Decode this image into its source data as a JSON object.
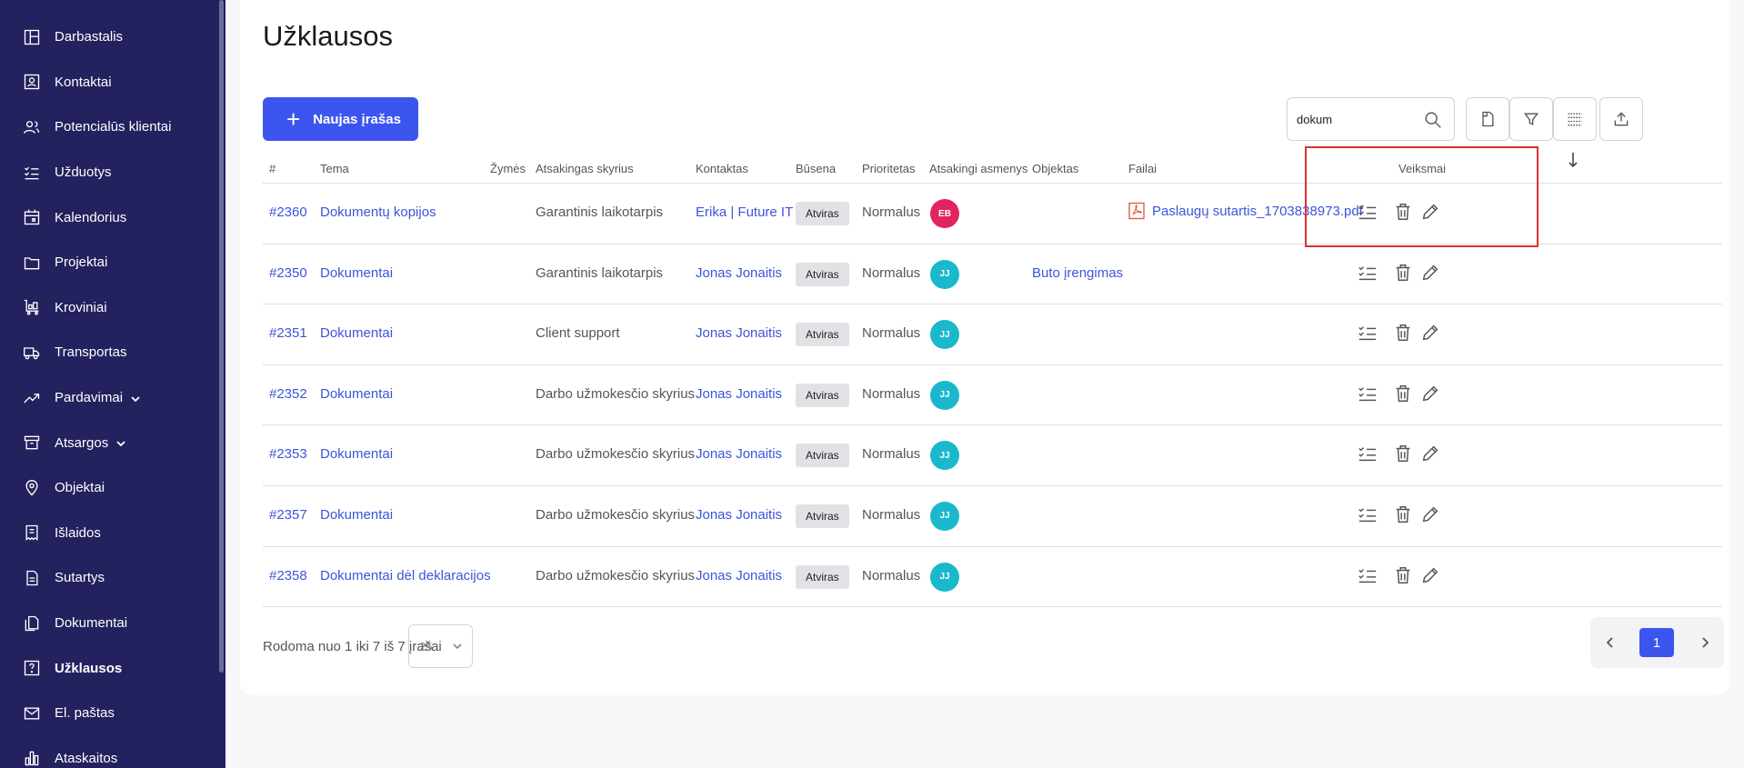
{
  "sidebar": {
    "items": [
      {
        "label": "Darbastalis",
        "icon": "dashboard-icon"
      },
      {
        "label": "Kontaktai",
        "icon": "contact-card-icon"
      },
      {
        "label": "Potencialūs klientai",
        "icon": "users-icon"
      },
      {
        "label": "Užduotys",
        "icon": "checklist-icon"
      },
      {
        "label": "Kalendorius",
        "icon": "calendar-icon"
      },
      {
        "label": "Projektai",
        "icon": "folder-icon"
      },
      {
        "label": "Kroviniai",
        "icon": "cart-icon"
      },
      {
        "label": "Transportas",
        "icon": "truck-icon"
      },
      {
        "label": "Pardavimai",
        "icon": "trend-icon",
        "expandable": true
      },
      {
        "label": "Atsargos",
        "icon": "archive-icon",
        "expandable": true
      },
      {
        "label": "Objektai",
        "icon": "map-pin-icon"
      },
      {
        "label": "Išlaidos",
        "icon": "receipt-icon"
      },
      {
        "label": "Sutartys",
        "icon": "document-icon"
      },
      {
        "label": "Dokumentai",
        "icon": "documents-icon"
      },
      {
        "label": "Užklausos",
        "icon": "question-icon",
        "active": true
      },
      {
        "label": "El. paštas",
        "icon": "mail-icon"
      },
      {
        "label": "Ataskaitos",
        "icon": "bar-chart-icon"
      }
    ]
  },
  "page": {
    "title": "Užklausos",
    "new_button_label": "Naujas įrašas",
    "search_value": "dokum"
  },
  "table": {
    "headers": {
      "id": "#",
      "subject": "Tema",
      "tags": "Žymės",
      "department": "Atsakingas skyrius",
      "contact": "Kontaktas",
      "status": "Būsena",
      "priority": "Prioritetas",
      "assignees": "Atsakingi asmenys",
      "object": "Objektas",
      "files": "Failai",
      "actions": "Veiksmai"
    },
    "rows": [
      {
        "id": "#2360",
        "subject": "Dokumentų kopijos",
        "department": "Garantinis laikotarpis",
        "contact": "Erika | Future IT",
        "status": "Atviras",
        "priority": "Normalus",
        "avatar": "EB",
        "avatar_color": "#e0245e",
        "object": "",
        "file": "Paslaugų sutartis_1703838973.pdf"
      },
      {
        "id": "#2350",
        "subject": "Dokumentai",
        "department": "Garantinis laikotarpis",
        "contact": "Jonas Jonaitis",
        "status": "Atviras",
        "priority": "Normalus",
        "avatar": "JJ",
        "avatar_color": "#1ab8cc",
        "object": "Buto įrengimas",
        "file": ""
      },
      {
        "id": "#2351",
        "subject": "Dokumentai",
        "department": "Client support",
        "contact": "Jonas Jonaitis",
        "status": "Atviras",
        "priority": "Normalus",
        "avatar": "JJ",
        "avatar_color": "#1ab8cc",
        "object": "",
        "file": ""
      },
      {
        "id": "#2352",
        "subject": "Dokumentai",
        "department": "Darbo užmokesčio skyrius",
        "contact": "Jonas Jonaitis",
        "status": "Atviras",
        "priority": "Normalus",
        "avatar": "JJ",
        "avatar_color": "#1ab8cc",
        "object": "",
        "file": ""
      },
      {
        "id": "#2353",
        "subject": "Dokumentai",
        "department": "Darbo užmokesčio skyrius",
        "contact": "Jonas Jonaitis",
        "status": "Atviras",
        "priority": "Normalus",
        "avatar": "JJ",
        "avatar_color": "#1ab8cc",
        "object": "",
        "file": ""
      },
      {
        "id": "#2357",
        "subject": "Dokumentai",
        "department": "Darbo užmokesčio skyrius",
        "contact": "Jonas Jonaitis",
        "status": "Atviras",
        "priority": "Normalus",
        "avatar": "JJ",
        "avatar_color": "#1ab8cc",
        "object": "",
        "file": ""
      },
      {
        "id": "#2358",
        "subject": "Dokumentai dėl deklaracijos",
        "department": "Darbo užmokesčio skyrius",
        "contact": "Jonas Jonaitis",
        "status": "Atviras",
        "priority": "Normalus",
        "avatar": "JJ",
        "avatar_color": "#1ab8cc",
        "object": "",
        "file": ""
      }
    ]
  },
  "footer": {
    "summary": "Rodoma nuo 1 iki 7 iš 7 įrašai",
    "per_page": "25",
    "current_page": "1"
  }
}
